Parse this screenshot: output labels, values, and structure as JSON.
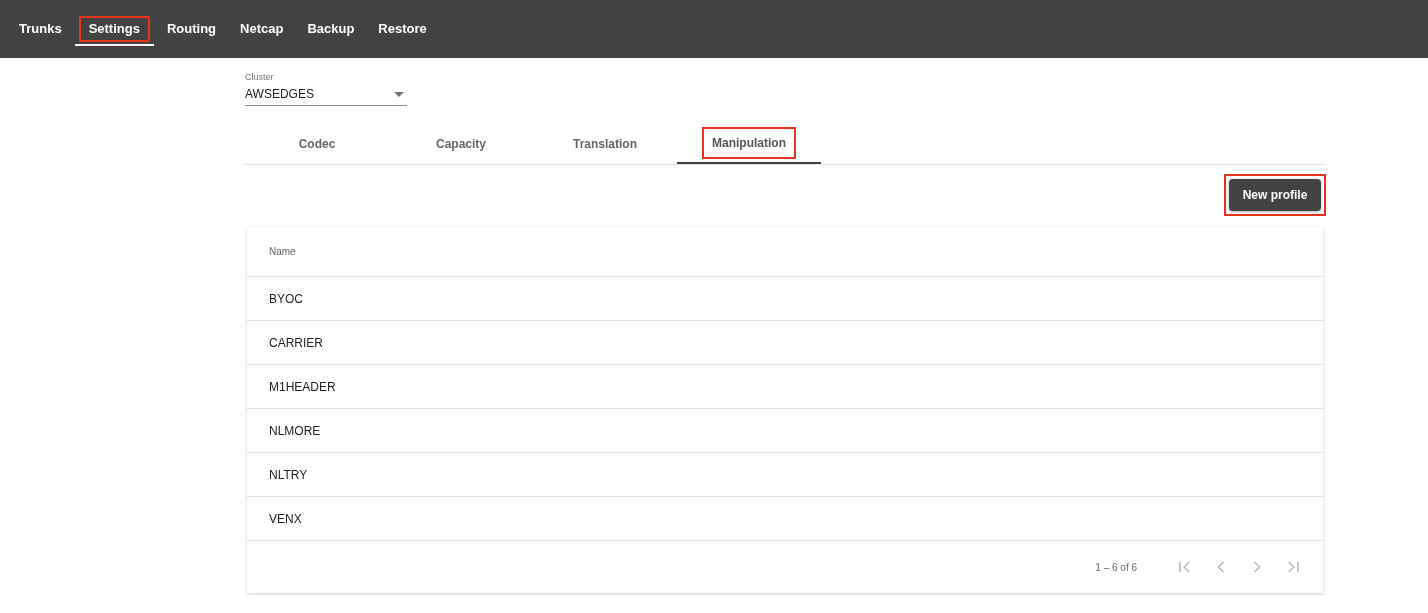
{
  "nav": [
    {
      "label": "Trunks",
      "selected": false,
      "highlighted": false
    },
    {
      "label": "Settings",
      "selected": true,
      "highlighted": true
    },
    {
      "label": "Routing",
      "selected": false,
      "highlighted": false
    },
    {
      "label": "Netcap",
      "selected": false,
      "highlighted": false
    },
    {
      "label": "Backup",
      "selected": false,
      "highlighted": false
    },
    {
      "label": "Restore",
      "selected": false,
      "highlighted": false
    }
  ],
  "cluster": {
    "label": "Cluster",
    "value": "AWSEDGES"
  },
  "tabs": [
    {
      "label": "Codec",
      "selected": false,
      "highlighted": false
    },
    {
      "label": "Capacity",
      "selected": false,
      "highlighted": false
    },
    {
      "label": "Translation",
      "selected": false,
      "highlighted": false
    },
    {
      "label": "Manipulation",
      "selected": true,
      "highlighted": true
    }
  ],
  "new_profile_button": {
    "label": "New profile",
    "highlighted": true
  },
  "table": {
    "columns": [
      "Name"
    ],
    "rows": [
      [
        "BYOC"
      ],
      [
        "CARRIER"
      ],
      [
        "M1HEADER"
      ],
      [
        "NLMORE"
      ],
      [
        "NLTRY"
      ],
      [
        "VENX"
      ]
    ]
  },
  "paginator": {
    "range": "1 – 6 of 6",
    "buttons": [
      {
        "kind": "first",
        "disabled": true
      },
      {
        "kind": "prev",
        "disabled": true
      },
      {
        "kind": "next",
        "disabled": true
      },
      {
        "kind": "last",
        "disabled": true
      }
    ]
  }
}
